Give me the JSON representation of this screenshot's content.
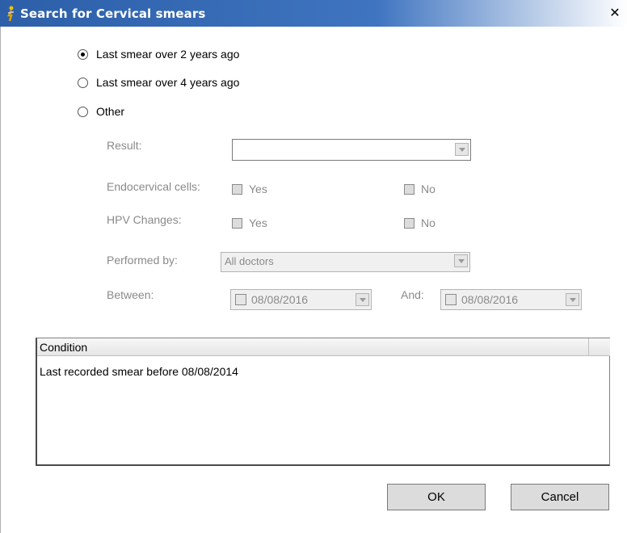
{
  "window": {
    "title": "Search for Cervical smears",
    "close_symbol": "✕",
    "icon": "app-figure-icon"
  },
  "options": [
    {
      "label": "Last smear over 2 years ago",
      "checked": true
    },
    {
      "label": "Last smear over 4 years ago",
      "checked": false
    },
    {
      "label": "Other",
      "checked": false
    }
  ],
  "criteria": {
    "result_label": "Result:",
    "result_value": "",
    "endocervical_label": "Endocervical cells:",
    "hpv_label": "HPV Changes:",
    "yes_label": "Yes",
    "no_label": "No",
    "performed_label": "Performed by:",
    "performed_value": "All doctors",
    "between_label": "Between:",
    "between_date": "08/08/2016",
    "and_label": "And:",
    "and_date": "08/08/2016"
  },
  "conditions": {
    "header": "Condition",
    "rows": [
      "Last recorded smear before 08/08/2014"
    ]
  },
  "buttons": {
    "ok_label": "OK",
    "cancel_label": "Cancel"
  }
}
